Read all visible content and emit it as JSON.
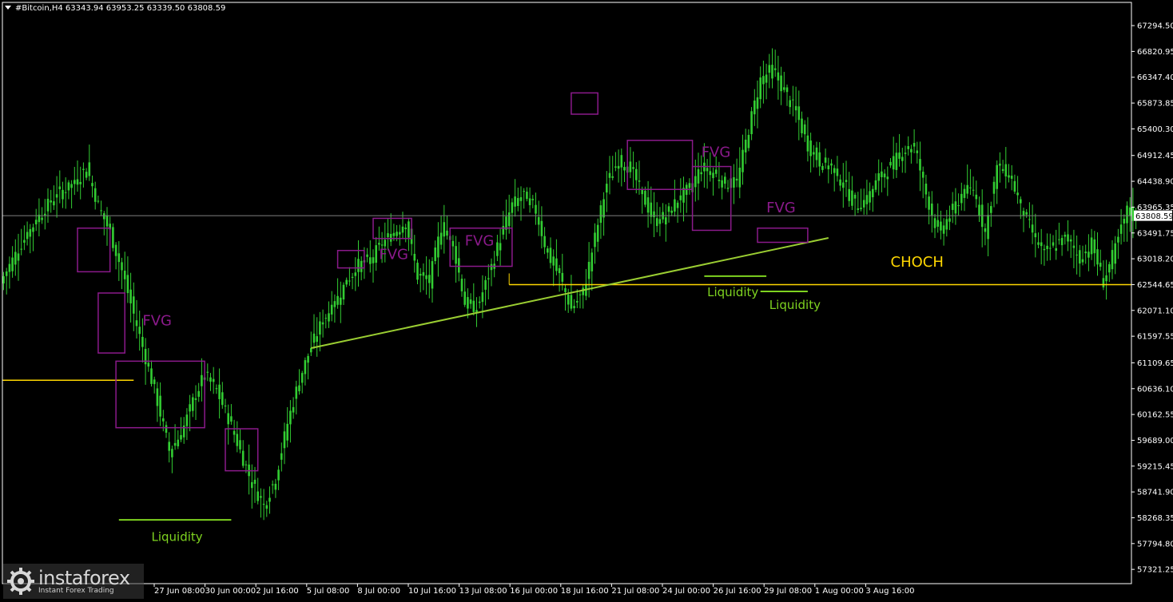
{
  "header": {
    "symbol_line": "#Bitcoin,H4  63343.94 63953.25 63339.50 63808.59"
  },
  "colors": {
    "background": "#000000",
    "candle": "#32cd32",
    "axis": "#ffffff",
    "fvg_box": "#8b1a8b",
    "liquidity": "#7ed320",
    "trendline": "#9acd32",
    "choch_line": "#ffd700",
    "price_line": "#7f7f7f"
  },
  "watermark": {
    "brand": "instaforex",
    "tagline": "Instant Forex Trading",
    "icon": "gear-icon"
  },
  "chart_data": {
    "type": "candlestick",
    "symbol": "#Bitcoin",
    "timeframe": "H4",
    "ohlc_current": {
      "open": 63343.94,
      "high": 63953.25,
      "low": 63339.5,
      "close": 63808.59
    },
    "current_price_label": "63808.59",
    "y_range": [
      57060,
      67720
    ],
    "price_ticks": [
      "67294.50",
      "66820.95",
      "66347.40",
      "65873.85",
      "65400.30",
      "64912.45",
      "64438.90",
      "63965.35",
      "63491.75",
      "63018.20",
      "62544.65",
      "62071.10",
      "61597.55",
      "61109.65",
      "60636.10",
      "60162.55",
      "59689.00",
      "59215.45",
      "58741.90",
      "58268.35",
      "57794.80",
      "57321.25"
    ],
    "time_ticks": [
      "27 Jun 08:00",
      "30 Jun 00:00",
      "2 Jul 16:00",
      "5 Jul 08:00",
      "8 Jul 00:00",
      "10 Jul 16:00",
      "13 Jul 08:00",
      "16 Jul 00:00",
      "18 Jul 16:00",
      "21 Jul 08:00",
      "24 Jul 00:00",
      "26 Jul 16:00",
      "29 Jul 08:00",
      "1 Aug 00:00",
      "3 Aug 16:00"
    ],
    "anchors": [
      [
        0,
        62700
      ],
      [
        6,
        63300
      ],
      [
        12,
        63800
      ],
      [
        18,
        64200
      ],
      [
        24,
        64400
      ],
      [
        28,
        64700
      ],
      [
        32,
        64000
      ],
      [
        36,
        63500
      ],
      [
        40,
        62800
      ],
      [
        44,
        62000
      ],
      [
        48,
        61200
      ],
      [
        52,
        60400
      ],
      [
        56,
        59500
      ],
      [
        60,
        59800
      ],
      [
        64,
        60400
      ],
      [
        68,
        60900
      ],
      [
        72,
        60600
      ],
      [
        76,
        60100
      ],
      [
        80,
        59500
      ],
      [
        84,
        58900
      ],
      [
        88,
        58500
      ],
      [
        92,
        59000
      ],
      [
        96,
        60000
      ],
      [
        100,
        60800
      ],
      [
        104,
        61400
      ],
      [
        108,
        61900
      ],
      [
        112,
        62200
      ],
      [
        116,
        62600
      ],
      [
        120,
        62900
      ],
      [
        124,
        63000
      ],
      [
        128,
        63300
      ],
      [
        132,
        63500
      ],
      [
        136,
        63700
      ],
      [
        140,
        62700
      ],
      [
        144,
        62600
      ],
      [
        148,
        63600
      ],
      [
        152,
        63300
      ],
      [
        156,
        62200
      ],
      [
        160,
        62100
      ],
      [
        164,
        62700
      ],
      [
        168,
        63400
      ],
      [
        172,
        64000
      ],
      [
        176,
        64200
      ],
      [
        180,
        63900
      ],
      [
        184,
        63100
      ],
      [
        188,
        62700
      ],
      [
        192,
        62100
      ],
      [
        196,
        62400
      ],
      [
        200,
        63400
      ],
      [
        204,
        64400
      ],
      [
        208,
        64800
      ],
      [
        212,
        64700
      ],
      [
        216,
        64200
      ],
      [
        220,
        63700
      ],
      [
        224,
        63800
      ],
      [
        228,
        64100
      ],
      [
        232,
        64300
      ],
      [
        236,
        64700
      ],
      [
        240,
        64600
      ],
      [
        244,
        64400
      ],
      [
        248,
        64400
      ],
      [
        252,
        65400
      ],
      [
        256,
        66300
      ],
      [
        260,
        66500
      ],
      [
        264,
        66100
      ],
      [
        268,
        65700
      ],
      [
        272,
        65100
      ],
      [
        276,
        64800
      ],
      [
        280,
        64700
      ],
      [
        284,
        64400
      ],
      [
        288,
        64000
      ],
      [
        292,
        64100
      ],
      [
        296,
        64500
      ],
      [
        300,
        64700
      ],
      [
        304,
        65000
      ],
      [
        308,
        65100
      ],
      [
        312,
        64200
      ],
      [
        316,
        63500
      ],
      [
        320,
        63800
      ],
      [
        324,
        64200
      ],
      [
        328,
        64300
      ],
      [
        332,
        63500
      ],
      [
        336,
        64700
      ],
      [
        340,
        64600
      ],
      [
        344,
        64000
      ],
      [
        348,
        63500
      ],
      [
        352,
        63100
      ],
      [
        356,
        63300
      ],
      [
        360,
        63400
      ],
      [
        364,
        63000
      ],
      [
        368,
        63300
      ],
      [
        372,
        62600
      ],
      [
        376,
        63200
      ],
      [
        380,
        63900
      ],
      [
        382,
        63800
      ]
    ],
    "boxes": [
      {
        "name": "fvg-box",
        "x": [
          25,
          36
        ],
        "y": [
          63580,
          62780
        ]
      },
      {
        "name": "fvg-box",
        "x": [
          32,
          41
        ],
        "y": [
          62390,
          61290
        ]
      },
      {
        "name": "fvg-box",
        "x": [
          38,
          68
        ],
        "y": [
          61140,
          59920
        ]
      },
      {
        "name": "fvg-box",
        "x": [
          75,
          86
        ],
        "y": [
          59900,
          59130
        ]
      },
      {
        "name": "fvg-box",
        "x": [
          113,
          122
        ],
        "y": [
          63170,
          62850
        ]
      },
      {
        "name": "fvg-box",
        "x": [
          125,
          138
        ],
        "y": [
          63760,
          63390
        ]
      },
      {
        "name": "fvg-box",
        "x": [
          151,
          172
        ],
        "y": [
          63580,
          62880
        ]
      },
      {
        "name": "fvg-box",
        "x": [
          192,
          201
        ],
        "y": [
          66060,
          65670
        ]
      },
      {
        "name": "fvg-box",
        "x": [
          211,
          233
        ],
        "y": [
          65190,
          64290
        ]
      },
      {
        "name": "fvg-box",
        "x": [
          233,
          246
        ],
        "y": [
          64710,
          63540
        ]
      },
      {
        "name": "fvg-box",
        "x": [
          255,
          272
        ],
        "y": [
          63580,
          63320
        ]
      }
    ],
    "box_labels": [
      {
        "text": "FVG",
        "x": 47,
        "y": 61800,
        "color": "#8b1a8b"
      },
      {
        "text": "FVG",
        "x": 127,
        "y": 63010,
        "color": "#8b1a8b"
      },
      {
        "text": "FVG",
        "x": 156,
        "y": 63260,
        "color": "#8b1a8b"
      },
      {
        "text": "FVG",
        "x": 236,
        "y": 64890,
        "color": "#8b1a8b"
      },
      {
        "text": "FVG",
        "x": 258,
        "y": 63870,
        "color": "#8b1a8b"
      }
    ],
    "liquidity": [
      {
        "x": [
          39,
          77
        ],
        "y": 58230,
        "label": "Liquidity",
        "label_x": 50,
        "label_y": 57840
      },
      {
        "x": [
          237,
          258
        ],
        "y": 62700,
        "label": "Liquidity",
        "label_x": 238,
        "label_y": 62330
      },
      {
        "x": [
          256,
          272
        ],
        "y": 62420,
        "label": "Liquidity",
        "label_x": 259,
        "label_y": 62100
      }
    ],
    "trendline": {
      "x": [
        104,
        279
      ],
      "y": [
        61380,
        63400
      ]
    },
    "choch": {
      "x1": 171,
      "y": 62544.65,
      "label": "CHOCH",
      "label_x": 300,
      "label_y": 62870
    },
    "old_level": {
      "x": [
        0,
        44
      ],
      "y": 60790
    },
    "current_price": 63808.59
  }
}
